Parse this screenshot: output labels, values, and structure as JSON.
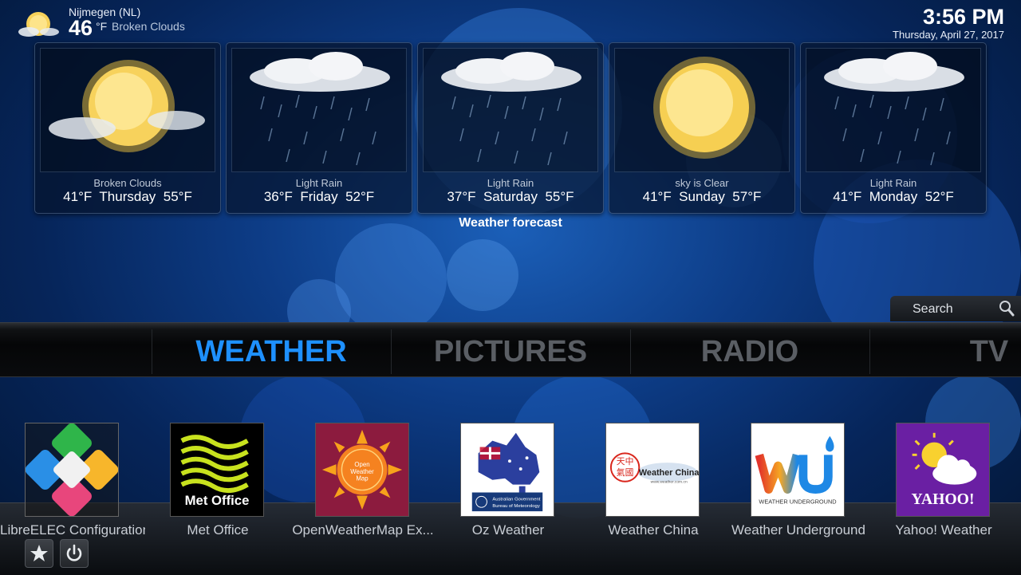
{
  "header": {
    "location": "Nijmegen (NL)",
    "temperature": "46",
    "unit": "°F",
    "condition": "Broken Clouds",
    "time": "3:56 PM",
    "date": "Thursday, April 27, 2017",
    "icon": "partly-cloudy-sun-icon"
  },
  "forecast": {
    "label": "Weather forecast",
    "days": [
      {
        "condition": "Broken Clouds",
        "low": "41°F",
        "day": "Thursday",
        "high": "55°F",
        "icon": "sun-cloud-icon"
      },
      {
        "condition": "Light Rain",
        "low": "36°F",
        "day": "Friday",
        "high": "52°F",
        "icon": "rain-cloud-icon"
      },
      {
        "condition": "Light Rain",
        "low": "37°F",
        "day": "Saturday",
        "high": "55°F",
        "icon": "rain-cloud-icon"
      },
      {
        "condition": "sky is Clear",
        "low": "41°F",
        "day": "Sunday",
        "high": "57°F",
        "icon": "sun-icon"
      },
      {
        "condition": "Light Rain",
        "low": "41°F",
        "day": "Monday",
        "high": "52°F",
        "icon": "rain-cloud-icon"
      }
    ]
  },
  "search": {
    "label": "Search",
    "icon": "search-icon"
  },
  "menu": {
    "items": [
      {
        "label": "WEATHER",
        "active": true
      },
      {
        "label": "PICTURES",
        "active": false
      },
      {
        "label": "RADIO",
        "active": false
      },
      {
        "label": "TV",
        "active": false
      }
    ],
    "active_color": "#1e90ff",
    "inactive_color": "#5a5e64"
  },
  "addons": [
    {
      "name": "LibreELEC Configuration",
      "icon": "libreelec-logo-icon"
    },
    {
      "name": "Met Office",
      "icon": "met-office-logo-icon",
      "logo_text": "Met Office"
    },
    {
      "name": "OpenWeatherMap Ex...",
      "icon": "openweathermap-logo-icon",
      "logo_text": "Open Weather Map"
    },
    {
      "name": "Oz Weather",
      "icon": "oz-weather-logo-icon",
      "logo_text": "Australian Government Bureau of Meteorology"
    },
    {
      "name": "Weather China",
      "icon": "weather-china-logo-icon",
      "logo_text": "Weather China",
      "logo_subtext": "www.weather.com.cn"
    },
    {
      "name": "Weather Underground",
      "icon": "weather-underground-logo-icon",
      "logo_text": "WEATHER UNDERGROUND"
    },
    {
      "name": "Yahoo! Weather",
      "icon": "yahoo-weather-logo-icon",
      "logo_text": "YAHOO!"
    }
  ],
  "buttons": [
    {
      "name": "favourites",
      "icon": "star-icon"
    },
    {
      "name": "power",
      "icon": "power-icon"
    }
  ]
}
